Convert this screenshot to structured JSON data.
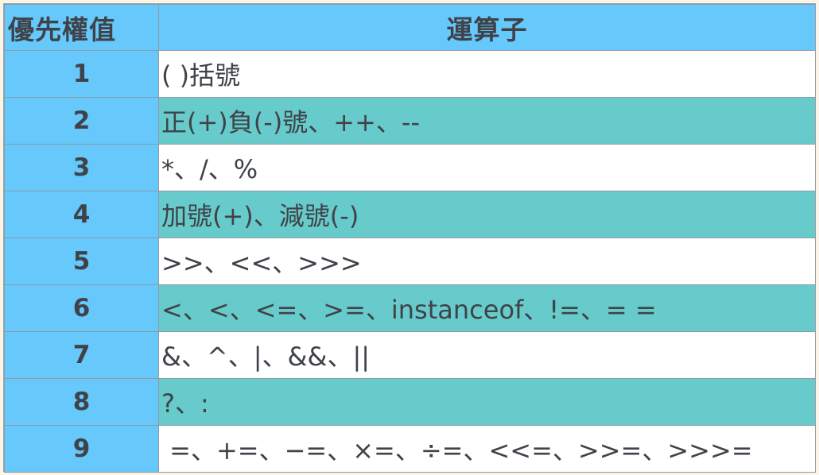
{
  "table": {
    "headers": {
      "priority": "優先權值",
      "operator": "運算子"
    },
    "rows": [
      {
        "priority": "1",
        "operators": "( )括號"
      },
      {
        "priority": "2",
        "operators": "正(+)負(-)號、++、--"
      },
      {
        "priority": "3",
        "operators": "*、/、%"
      },
      {
        "priority": "4",
        "operators": "加號(+)、減號(-)"
      },
      {
        "priority": "5",
        "operators": ">>、<<、>>>"
      },
      {
        "priority": "6",
        "operators": "<、<、<=、>=、instanceof、!=、= ="
      },
      {
        "priority": "7",
        "operators": "&、^、|、&&、||"
      },
      {
        "priority": "8",
        "operators": "?、:"
      },
      {
        "priority": "9",
        "operators": " =、+=、−=、×=、÷=、<<=、>>=、>>>="
      }
    ]
  },
  "colors": {
    "header_bg": "#66c8fb",
    "priority_col_bg": "#66c8fb",
    "even_row_bg": "#68cbcb",
    "odd_row_bg": "#ffffff",
    "text": "#3f4349",
    "page_bg": "#faf5e6"
  }
}
